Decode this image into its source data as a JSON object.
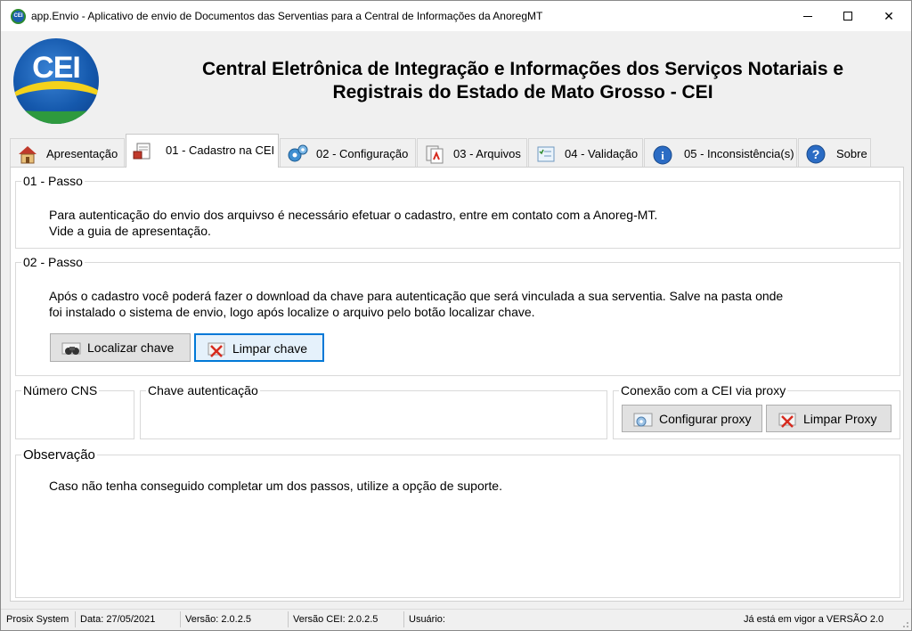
{
  "window": {
    "title": "app.Envio - Aplicativo de envio  de Documentos das Serventias para a Central de Informações da AnoregMT",
    "app_icon_text": "CEI",
    "minimize": "",
    "maximize": "",
    "close": "✕"
  },
  "header": {
    "logo_text": "CEI",
    "title_line1": "Central Eletrônica de Integração e Informações dos Serviços Notariais e",
    "title_line2": "Registrais do Estado de Mato Grosso - CEI"
  },
  "tabs": [
    {
      "label": "Apresentação",
      "icon": "house-icon",
      "active": false
    },
    {
      "label": "01 - Cadastro na CEI",
      "icon": "document-stamp-icon",
      "active": true
    },
    {
      "label": "02 - Configuração",
      "icon": "gears-icon",
      "active": false
    },
    {
      "label": "03 - Arquivos",
      "icon": "pdf-files-icon",
      "active": false
    },
    {
      "label": "04 - Validação",
      "icon": "checklist-icon",
      "active": false
    },
    {
      "label": "05 - Inconsistência(s)",
      "icon": "info-icon",
      "active": false
    },
    {
      "label": "Sobre",
      "icon": "help-icon",
      "active": false
    }
  ],
  "step1": {
    "caption": "01 - Passo",
    "line1": "Para autenticação do envio dos arquivso é necessário efetuar o cadastro, entre em contato com a Anoreg-MT.",
    "line2": "Vide a guia de apresentação."
  },
  "step2": {
    "caption": "02 - Passo",
    "line1": "Após o cadastro você poderá fazer o download da chave para autenticação que será vinculada a sua serventia.  Salve na pasta onde",
    "line2": "foi instalado o sistema de envio,  logo após localize o arquivo pelo botão localizar chave.",
    "locate_button": "Localizar chave",
    "clear_button": "Limpar chave"
  },
  "cns": {
    "caption": "Número CNS",
    "value": ""
  },
  "key": {
    "caption": "Chave autenticação",
    "value": ""
  },
  "proxy": {
    "caption": "Conexão com a CEI via proxy",
    "configure_button": "Configurar proxy",
    "clear_button": "Limpar Proxy"
  },
  "observation": {
    "caption": "Observação",
    "text": "Caso não tenha conseguido completar um dos passos, utilize a opção de suporte."
  },
  "statusbar": {
    "company": "Prosix System",
    "date": "Data: 27/05/2021",
    "version": "Versão: 2.0.2.5",
    "cei_version": "Versão CEI: 2.0.2.5",
    "user": "Usuário:",
    "notice": "Já está em vigor a VERSÃO 2.0"
  }
}
